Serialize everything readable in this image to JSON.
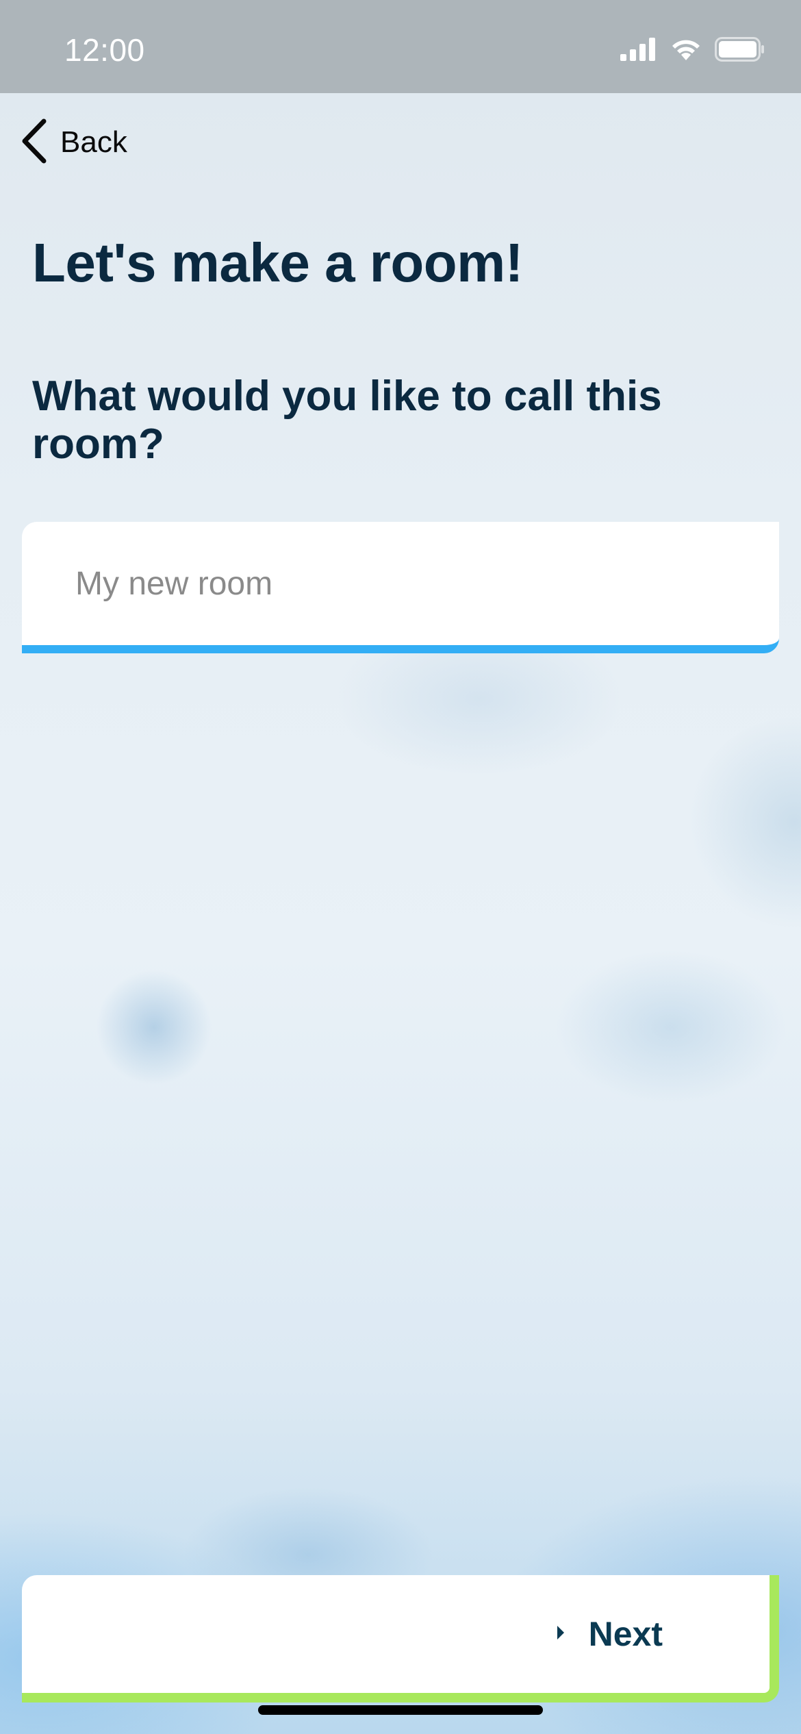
{
  "status_bar": {
    "time": "12:00",
    "signal_icon": "cellular-signal-icon",
    "wifi_icon": "wifi-icon",
    "battery_icon": "battery-icon"
  },
  "nav": {
    "back_icon": "chevron-left-icon",
    "back_label": "Back"
  },
  "page": {
    "title": "Let's make a room!",
    "question": "What would you like to call this room?"
  },
  "room_name_input": {
    "value": "",
    "placeholder": "My new room"
  },
  "next_button": {
    "icon": "caret-right-icon",
    "label": "Next"
  },
  "colors": {
    "heading": "#0b2940",
    "input_underline": "#33aef5",
    "next_accent": "#a8e85c",
    "status_bar": "#adb5ba"
  }
}
